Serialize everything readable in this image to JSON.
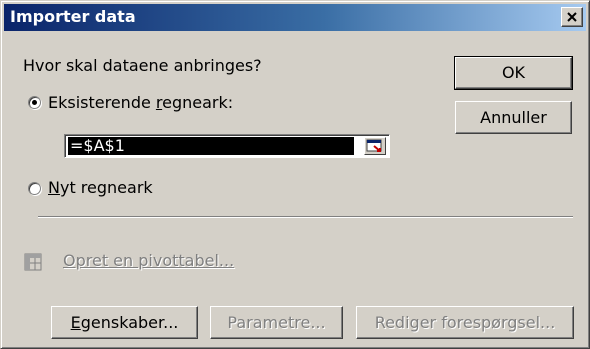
{
  "window": {
    "title": "Importer data",
    "close_glyph": "✕"
  },
  "question": "Hvor skal dataene anbringes?",
  "options": {
    "existing": {
      "label_prefix": "Eksisterende ",
      "label_mnemonic": "r",
      "label_suffix": "egneark:",
      "selected": true
    },
    "new": {
      "label_mnemonic": "N",
      "label_suffix": "yt regneark",
      "selected": false
    }
  },
  "range_input": {
    "value": "=$A$1",
    "button_icon": "collapse-dialog-icon"
  },
  "pivot_link": {
    "label": "Opret en pivottabel...",
    "icon": "pivot-table-icon",
    "enabled": false
  },
  "buttons": {
    "ok": "OK",
    "cancel": "Annuller",
    "properties_mnemonic": "E",
    "properties_rest": "genskaber...",
    "parameters": "Parametre...",
    "edit_query": "Rediger forespørgsel..."
  }
}
